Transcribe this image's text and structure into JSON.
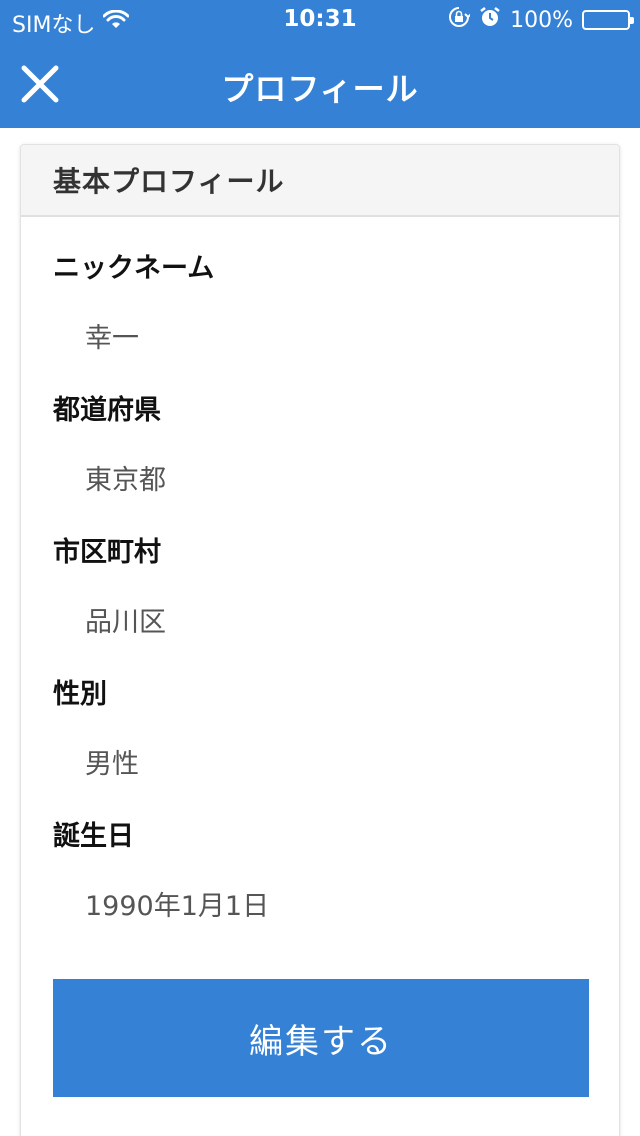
{
  "status_bar": {
    "carrier": "SIMなし",
    "time": "10:31",
    "battery_percent": "100%",
    "battery_level": 1.0,
    "icons": [
      "wifi-icon",
      "orientation-lock-icon",
      "alarm-icon",
      "battery-icon"
    ]
  },
  "nav": {
    "title": "プロフィール",
    "close_icon": "close-icon"
  },
  "card": {
    "header_title": "基本プロフィール",
    "fields": [
      {
        "label": "ニックネーム",
        "value": "幸一"
      },
      {
        "label": "都道府県",
        "value": "東京都"
      },
      {
        "label": "市区町村",
        "value": "品川区"
      },
      {
        "label": "性別",
        "value": "男性"
      },
      {
        "label": "誕生日",
        "value": "1990年1月1日"
      }
    ],
    "edit_button_label": "編集する"
  },
  "colors": {
    "accent": "#3481d6",
    "header_bg": "#f5f5f5",
    "label_text": "#111111",
    "value_text": "#555555"
  }
}
